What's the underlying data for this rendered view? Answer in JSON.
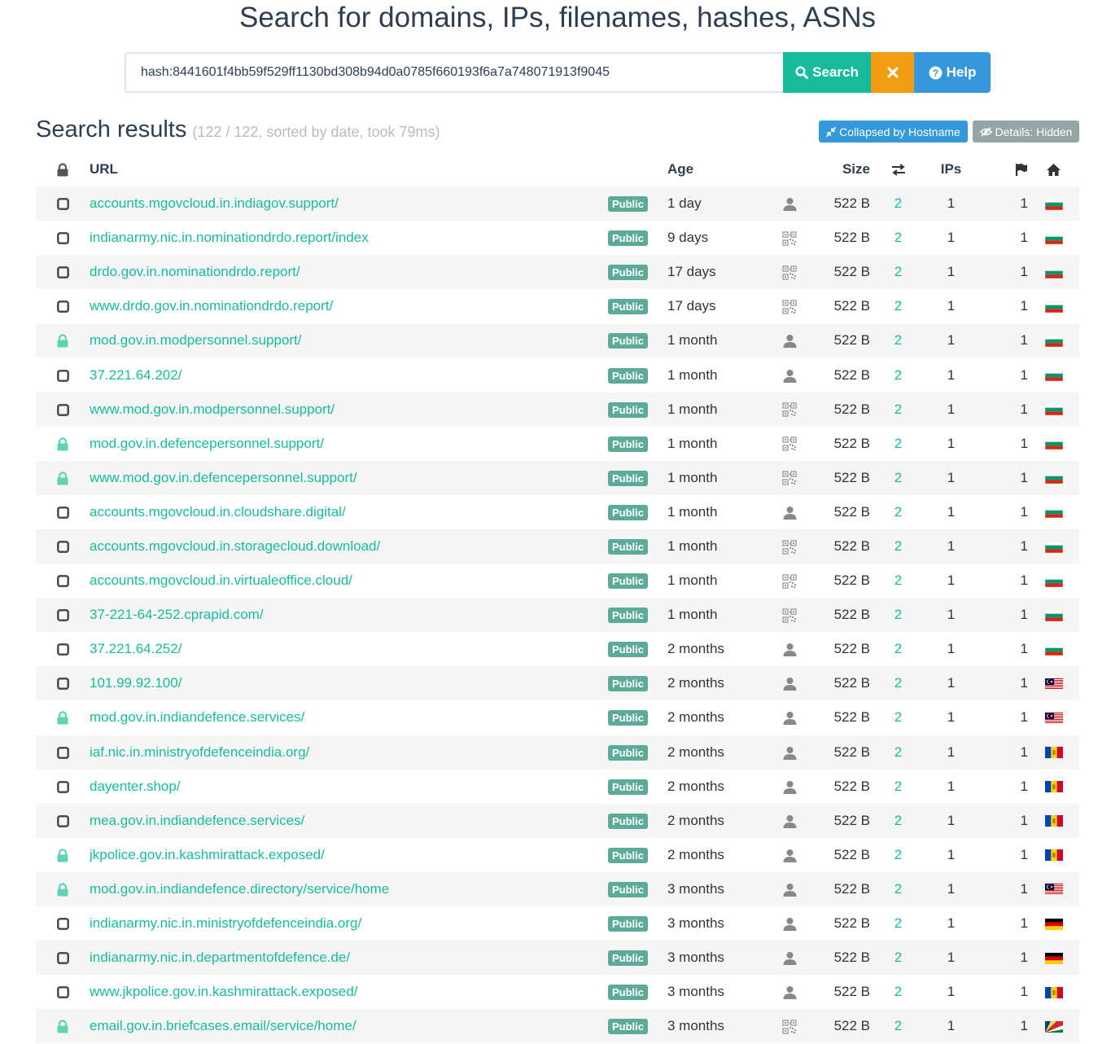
{
  "page": {
    "title": "Search for domains, IPs, filenames, hashes, ASNs"
  },
  "search": {
    "query": "hash:8441601f4bb59f529ff1130bd308b94d0a0785f660193f6a7a748071913f9045",
    "search_label": "Search",
    "clear_icon": "times-icon",
    "help_label": "Help"
  },
  "results": {
    "heading": "Search results",
    "meta": "(122 / 122, sorted by date, took 79ms)",
    "collapse_label": "Collapsed by Hostname",
    "details_label": "Details: Hidden"
  },
  "columns": {
    "url": "URL",
    "age": "Age",
    "size": "Size",
    "ips": "IPs"
  },
  "colors": {
    "accent": "#18bc9c",
    "badge": "#5cab99",
    "lock_green": "#5fd3b5",
    "search_btn": "#18bc9c",
    "clear_btn": "#f39c12",
    "help_btn": "#3498db"
  },
  "rows": [
    {
      "lock": "unlocked",
      "url": "accounts.mgovcloud.in.indiagov.support/",
      "badge": "Public",
      "age": "1 day",
      "submitter": "user-icon",
      "size": "522 B",
      "redirects": "2",
      "ips": "1",
      "asns": "1",
      "flag": "bulgaria"
    },
    {
      "lock": "unlocked",
      "url": "indianarmy.nic.in.nominationdrdo.report/index",
      "badge": "Public",
      "age": "9 days",
      "submitter": "qr-icon",
      "size": "522 B",
      "redirects": "2",
      "ips": "1",
      "asns": "1",
      "flag": "bulgaria"
    },
    {
      "lock": "unlocked",
      "url": "drdo.gov.in.nominationdrdo.report/",
      "badge": "Public",
      "age": "17 days",
      "submitter": "qr-icon",
      "size": "522 B",
      "redirects": "2",
      "ips": "1",
      "asns": "1",
      "flag": "bulgaria"
    },
    {
      "lock": "unlocked",
      "url": "www.drdo.gov.in.nominationdrdo.report/",
      "badge": "Public",
      "age": "17 days",
      "submitter": "qr-icon",
      "size": "522 B",
      "redirects": "2",
      "ips": "1",
      "asns": "1",
      "flag": "bulgaria"
    },
    {
      "lock": "locked",
      "url": "mod.gov.in.modpersonnel.support/",
      "badge": "Public",
      "age": "1 month",
      "submitter": "user-icon",
      "size": "522 B",
      "redirects": "2",
      "ips": "1",
      "asns": "1",
      "flag": "bulgaria"
    },
    {
      "lock": "unlocked",
      "url": "37.221.64.202/",
      "badge": "Public",
      "age": "1 month",
      "submitter": "user-icon",
      "size": "522 B",
      "redirects": "2",
      "ips": "1",
      "asns": "1",
      "flag": "bulgaria"
    },
    {
      "lock": "unlocked",
      "url": "www.mod.gov.in.modpersonnel.support/",
      "badge": "Public",
      "age": "1 month",
      "submitter": "qr-icon",
      "size": "522 B",
      "redirects": "2",
      "ips": "1",
      "asns": "1",
      "flag": "bulgaria"
    },
    {
      "lock": "locked",
      "url": "mod.gov.in.defencepersonnel.support/",
      "badge": "Public",
      "age": "1 month",
      "submitter": "qr-icon",
      "size": "522 B",
      "redirects": "2",
      "ips": "1",
      "asns": "1",
      "flag": "bulgaria"
    },
    {
      "lock": "locked",
      "url": "www.mod.gov.in.defencepersonnel.support/",
      "badge": "Public",
      "age": "1 month",
      "submitter": "qr-icon",
      "size": "522 B",
      "redirects": "2",
      "ips": "1",
      "asns": "1",
      "flag": "bulgaria"
    },
    {
      "lock": "unlocked",
      "url": "accounts.mgovcloud.in.cloudshare.digital/",
      "badge": "Public",
      "age": "1 month",
      "submitter": "user-icon",
      "size": "522 B",
      "redirects": "2",
      "ips": "1",
      "asns": "1",
      "flag": "bulgaria"
    },
    {
      "lock": "unlocked",
      "url": "accounts.mgovcloud.in.storagecloud.download/",
      "badge": "Public",
      "age": "1 month",
      "submitter": "qr-icon",
      "size": "522 B",
      "redirects": "2",
      "ips": "1",
      "asns": "1",
      "flag": "bulgaria"
    },
    {
      "lock": "unlocked",
      "url": "accounts.mgovcloud.in.virtualeoffice.cloud/",
      "badge": "Public",
      "age": "1 month",
      "submitter": "qr-icon",
      "size": "522 B",
      "redirects": "2",
      "ips": "1",
      "asns": "1",
      "flag": "bulgaria"
    },
    {
      "lock": "unlocked",
      "url": "37-221-64-252.cprapid.com/",
      "badge": "Public",
      "age": "1 month",
      "submitter": "qr-icon",
      "size": "522 B",
      "redirects": "2",
      "ips": "1",
      "asns": "1",
      "flag": "bulgaria"
    },
    {
      "lock": "unlocked",
      "url": "37.221.64.252/",
      "badge": "Public",
      "age": "2 months",
      "submitter": "user-icon",
      "size": "522 B",
      "redirects": "2",
      "ips": "1",
      "asns": "1",
      "flag": "bulgaria"
    },
    {
      "lock": "unlocked",
      "url": "101.99.92.100/",
      "badge": "Public",
      "age": "2 months",
      "submitter": "user-icon",
      "size": "522 B",
      "redirects": "2",
      "ips": "1",
      "asns": "1",
      "flag": "malaysia"
    },
    {
      "lock": "locked",
      "url": "mod.gov.in.indiandefence.services/",
      "badge": "Public",
      "age": "2 months",
      "submitter": "user-icon",
      "size": "522 B",
      "redirects": "2",
      "ips": "1",
      "asns": "1",
      "flag": "malaysia"
    },
    {
      "lock": "unlocked",
      "url": "iaf.nic.in.ministryofdefenceindia.org/",
      "badge": "Public",
      "age": "2 months",
      "submitter": "user-icon",
      "size": "522 B",
      "redirects": "2",
      "ips": "1",
      "asns": "1",
      "flag": "moldova"
    },
    {
      "lock": "unlocked",
      "url": "dayenter.shop/",
      "badge": "Public",
      "age": "2 months",
      "submitter": "user-icon",
      "size": "522 B",
      "redirects": "2",
      "ips": "1",
      "asns": "1",
      "flag": "moldova"
    },
    {
      "lock": "unlocked",
      "url": "mea.gov.in.indiandefence.services/",
      "badge": "Public",
      "age": "2 months",
      "submitter": "user-icon",
      "size": "522 B",
      "redirects": "2",
      "ips": "1",
      "asns": "1",
      "flag": "moldova"
    },
    {
      "lock": "locked",
      "url": "jkpolice.gov.in.kashmirattack.exposed/",
      "badge": "Public",
      "age": "2 months",
      "submitter": "user-icon",
      "size": "522 B",
      "redirects": "2",
      "ips": "1",
      "asns": "1",
      "flag": "moldova"
    },
    {
      "lock": "locked",
      "url": "mod.gov.in.indiandefence.directory/service/home",
      "badge": "Public",
      "age": "3 months",
      "submitter": "user-icon",
      "size": "522 B",
      "redirects": "2",
      "ips": "1",
      "asns": "1",
      "flag": "malaysia"
    },
    {
      "lock": "unlocked",
      "url": "indianarmy.nic.in.ministryofdefenceindia.org/",
      "badge": "Public",
      "age": "3 months",
      "submitter": "user-icon",
      "size": "522 B",
      "redirects": "2",
      "ips": "1",
      "asns": "1",
      "flag": "germany"
    },
    {
      "lock": "unlocked",
      "url": "indianarmy.nic.in.departmentofdefence.de/",
      "badge": "Public",
      "age": "3 months",
      "submitter": "user-icon",
      "size": "522 B",
      "redirects": "2",
      "ips": "1",
      "asns": "1",
      "flag": "germany"
    },
    {
      "lock": "unlocked",
      "url": "www.jkpolice.gov.in.kashmirattack.exposed/",
      "badge": "Public",
      "age": "3 months",
      "submitter": "user-icon",
      "size": "522 B",
      "redirects": "2",
      "ips": "1",
      "asns": "1",
      "flag": "moldova"
    },
    {
      "lock": "locked",
      "url": "email.gov.in.briefcases.email/service/home/",
      "badge": "Public",
      "age": "3 months",
      "submitter": "qr-icon",
      "size": "522 B",
      "redirects": "2",
      "ips": "1",
      "asns": "1",
      "flag": "seychelles"
    }
  ]
}
